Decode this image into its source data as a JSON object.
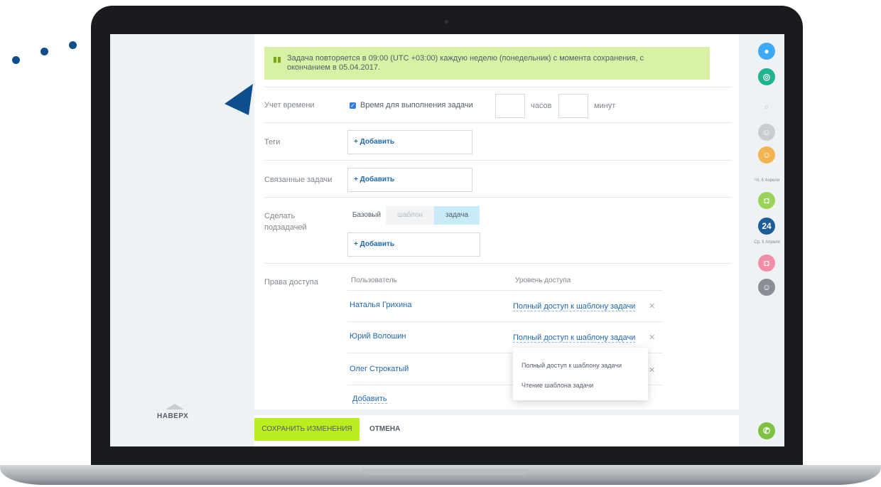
{
  "notice": {
    "icon": "calendar-icon",
    "text": "Задача повторяется в 09:00 (UTC +03:00) каждую неделю (понедельник) с момента сохранения, с окончанием в 05.04.2017."
  },
  "time_tracking": {
    "label": "Учет времени",
    "checkbox_label": "Время для выполнения задачи",
    "checked": true,
    "hours_unit": "часов",
    "minutes_unit": "минут",
    "hours_value": "",
    "minutes_value": ""
  },
  "tags": {
    "label": "Теги",
    "add_label": "+ Добавить"
  },
  "related": {
    "label": "Связанные задачи",
    "add_label": "+ Добавить"
  },
  "subtask": {
    "label_line1": "Сделать",
    "label_line2": "подзадачей",
    "segments": [
      "Базовый",
      "шаблон",
      "задача"
    ],
    "active_segment": "задача",
    "add_label": "+ Добавить"
  },
  "access": {
    "label": "Права доступа",
    "col_user": "Пользователь",
    "col_level": "Уровень доступа",
    "rows": [
      {
        "user": "Наталья Грихина",
        "level": "Полный доступ к шаблону задачи"
      },
      {
        "user": "Юрий Волошин",
        "level": "Полный доступ к шаблону задачи"
      },
      {
        "user": "Олег Строкатый",
        "level": ""
      }
    ],
    "add_user": "Добавить",
    "dropdown": [
      "Полный доступ к шаблону задачи",
      "Чтение шаблона задачи"
    ]
  },
  "footer": {
    "save": "СОХРАНИТЬ ИЗМЕНЕНИЯ",
    "cancel": "ОТМЕНА"
  },
  "left_panel": {
    "up_label": "НАВЕРХ"
  },
  "right_bar": {
    "date1": "Чт, 6 Апреля",
    "date2": "Ср, 5 Апреля",
    "badge_24": "24"
  },
  "colors": {
    "accent_green": "#bbed21",
    "link_blue": "#2067b0",
    "notice_bg": "#d9f1a4",
    "segment_active": "#c7ecf7"
  }
}
